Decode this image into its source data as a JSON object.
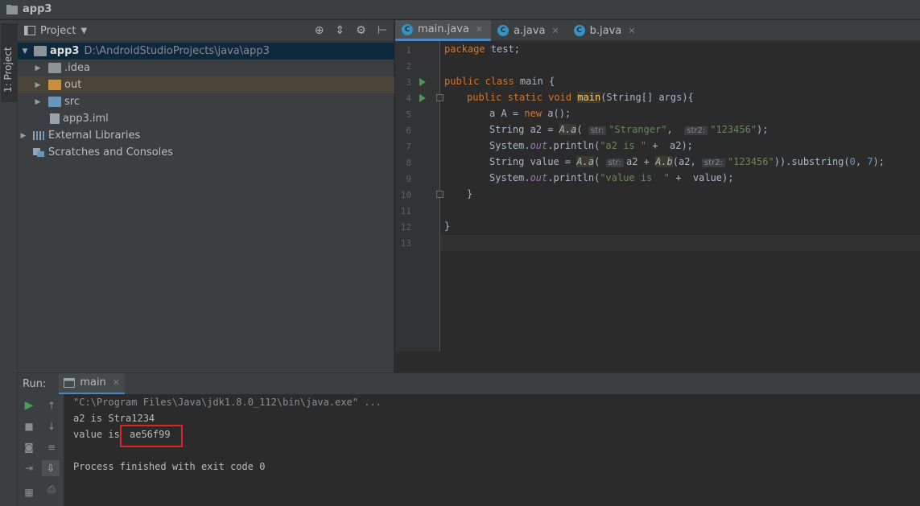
{
  "window": {
    "title": "app3"
  },
  "left_stripe": {
    "label": "1: Project"
  },
  "project_panel": {
    "title": "Project",
    "tree": [
      {
        "label": "app3",
        "path": "D:\\AndroidStudioProjects\\java\\app3"
      },
      {
        "label": ".idea"
      },
      {
        "label": "out"
      },
      {
        "label": "src"
      },
      {
        "label": "app3.iml"
      },
      {
        "label": "External Libraries"
      },
      {
        "label": "Scratches and Consoles"
      }
    ]
  },
  "editor": {
    "tabs": [
      {
        "label": "main.java",
        "icon": "C"
      },
      {
        "label": "a.java",
        "icon": "C"
      },
      {
        "label": "b.java",
        "icon": "C"
      }
    ],
    "line_numbers": [
      "1",
      "2",
      "3",
      "4",
      "5",
      "6",
      "7",
      "8",
      "9",
      "10",
      "11",
      "12",
      "13"
    ],
    "code": {
      "l1_kw": "package",
      "l1_rest": " test;",
      "l3_kw": "public class",
      "l3_rest": " main {",
      "l4_kw": "public static void",
      "l4_m": "main",
      "l4_rest": "(String[] args){",
      "l5_a": "a A = ",
      "l5_kw": "new",
      "l5_b": " a();",
      "l6_a": "String a2 = ",
      "l6_call": "A.a",
      "l6_open": "(",
      "l6_hint1": "str:",
      "l6_s1": "\"Stranger\"",
      "l6_comma": ",",
      "l6_hint2": "str2:",
      "l6_s2": "\"123456\"",
      "l6_end": ");",
      "l7_a": "System.",
      "l7_out": "out",
      "l7_b": ".println(",
      "l7_s": "\"a2 is \"",
      "l7_c": " +  a2);",
      "l8_a": "String value = ",
      "l8_call": "A.a",
      "l8_open": "(",
      "l8_hint1": "str:",
      "l8_b": "a2 + ",
      "l8_call2": "A.b",
      "l8_c": "(a2,",
      "l8_hint2": "str2:",
      "l8_s": "\"123456\"",
      "l8_d": ")).substring(",
      "l8_n1": "0",
      "l8_e": ", ",
      "l8_n2": "7",
      "l8_f": ");",
      "l9_a": "System.",
      "l9_out": "out",
      "l9_b": ".println(",
      "l9_s": "\"value is  \"",
      "l9_c": " +  value);",
      "l10": "}",
      "l12": "}"
    }
  },
  "run_panel": {
    "label": "Run:",
    "tab": "main",
    "console": [
      "\"C:\\Program Files\\Java\\jdk1.8.0_112\\bin\\java.exe\" ...",
      "a2 is Stra1234",
      "value is  ",
      "ae56f99",
      "Process finished with exit code 0"
    ]
  },
  "colors": {
    "accent": "#4a88c7",
    "highlight_box": "#e0232b",
    "keyword": "#cc7832",
    "string": "#6a8759",
    "number": "#6897bb"
  }
}
